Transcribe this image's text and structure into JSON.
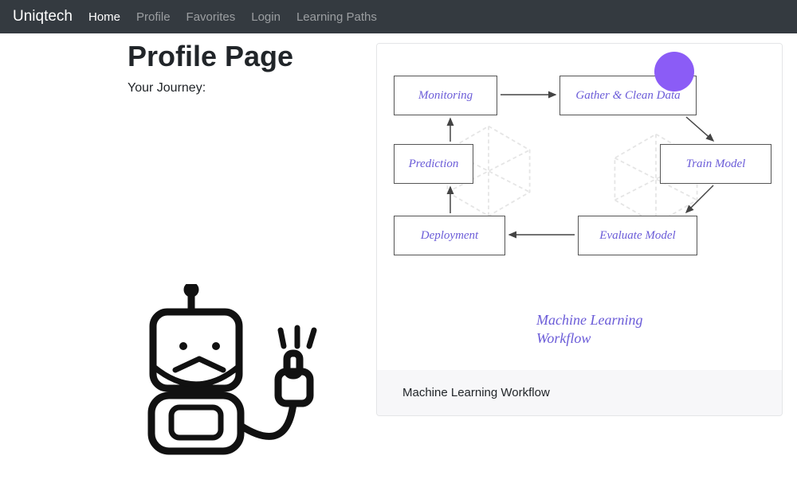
{
  "nav": {
    "brand": "Uniqtech",
    "items": [
      "Home",
      "Profile",
      "Favorites",
      "Login",
      "Learning Paths"
    ],
    "activeIndex": 0
  },
  "page": {
    "title": "Profile Page",
    "subtitle": "Your Journey:"
  },
  "diagram": {
    "nodes": {
      "monitoring": "Monitoring",
      "gather": "Gather & Clean Data",
      "prediction": "Prediction",
      "train": "Train Model",
      "deployment": "Deployment",
      "evaluate": "Evaluate Model"
    },
    "label_line1": "Machine Learning",
    "label_line2": "Workflow"
  },
  "card": {
    "caption": "Machine Learning Workflow"
  }
}
